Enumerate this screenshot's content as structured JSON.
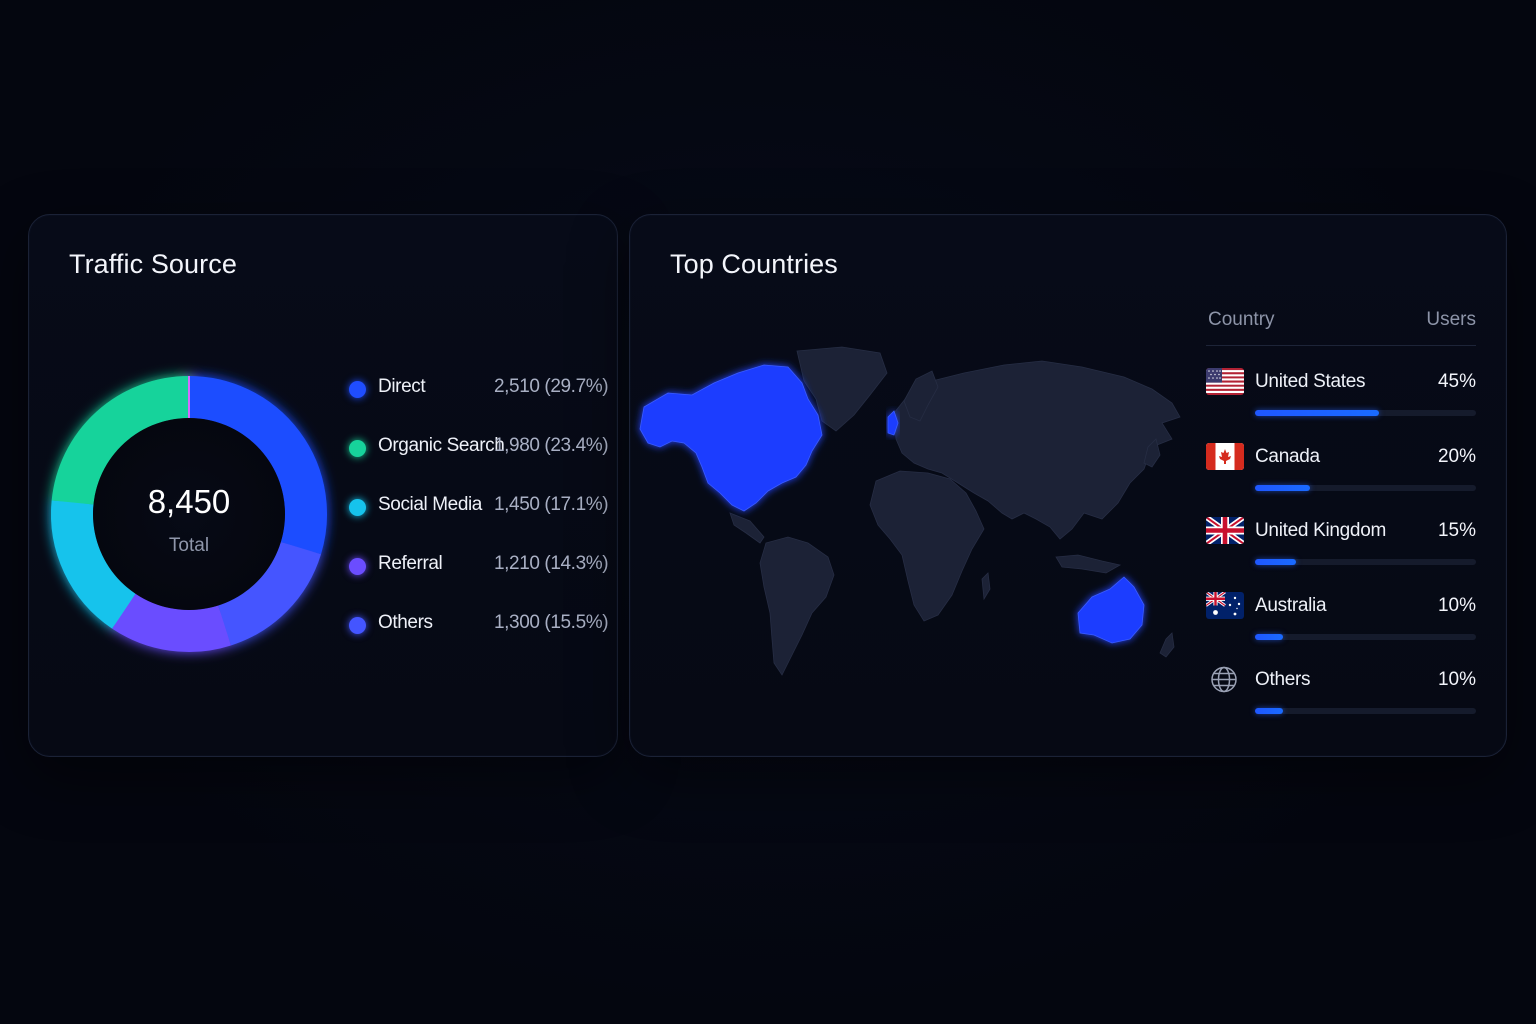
{
  "traffic": {
    "title": "Traffic Source",
    "total_value": "8,450",
    "total_label": "Total",
    "items": [
      {
        "label": "Direct",
        "value": "2,510 (29.7%)",
        "count": 2510,
        "color": "#1f4dff"
      },
      {
        "label": "Organic Search",
        "value": "1,980 (23.4%)",
        "count": 1980,
        "color": "#17d39b"
      },
      {
        "label": "Social Media",
        "value": "1,450 (17.1%)",
        "count": 1450,
        "color": "#16c3ec"
      },
      {
        "label": "Referral",
        "value": "1,210 (14.3%)",
        "count": 1210,
        "color": "#6b4dff"
      },
      {
        "label": "Others",
        "value": "1,300 (15.5%)",
        "count": 1300,
        "color": "#4455ff"
      }
    ]
  },
  "countries": {
    "title": "Top Countries",
    "col_country": "Country",
    "col_users": "Users",
    "highlight_color": "#1a3cff",
    "land_color": "#1c2236",
    "rows": [
      {
        "name": "United States",
        "pct_label": "45%",
        "pct": 45,
        "flag_icon": "us-flag-icon"
      },
      {
        "name": "Canada",
        "pct_label": "20%",
        "pct": 20,
        "flag_icon": "canada-flag-icon"
      },
      {
        "name": "United Kingdom",
        "pct_label": "15%",
        "pct": 15,
        "flag_icon": "uk-flag-icon"
      },
      {
        "name": "Australia",
        "pct_label": "10%",
        "pct": 10,
        "flag_icon": "australia-flag-icon"
      },
      {
        "name": "Others",
        "pct_label": "10%",
        "pct": 10,
        "flag_icon": "globe-icon"
      }
    ]
  }
}
